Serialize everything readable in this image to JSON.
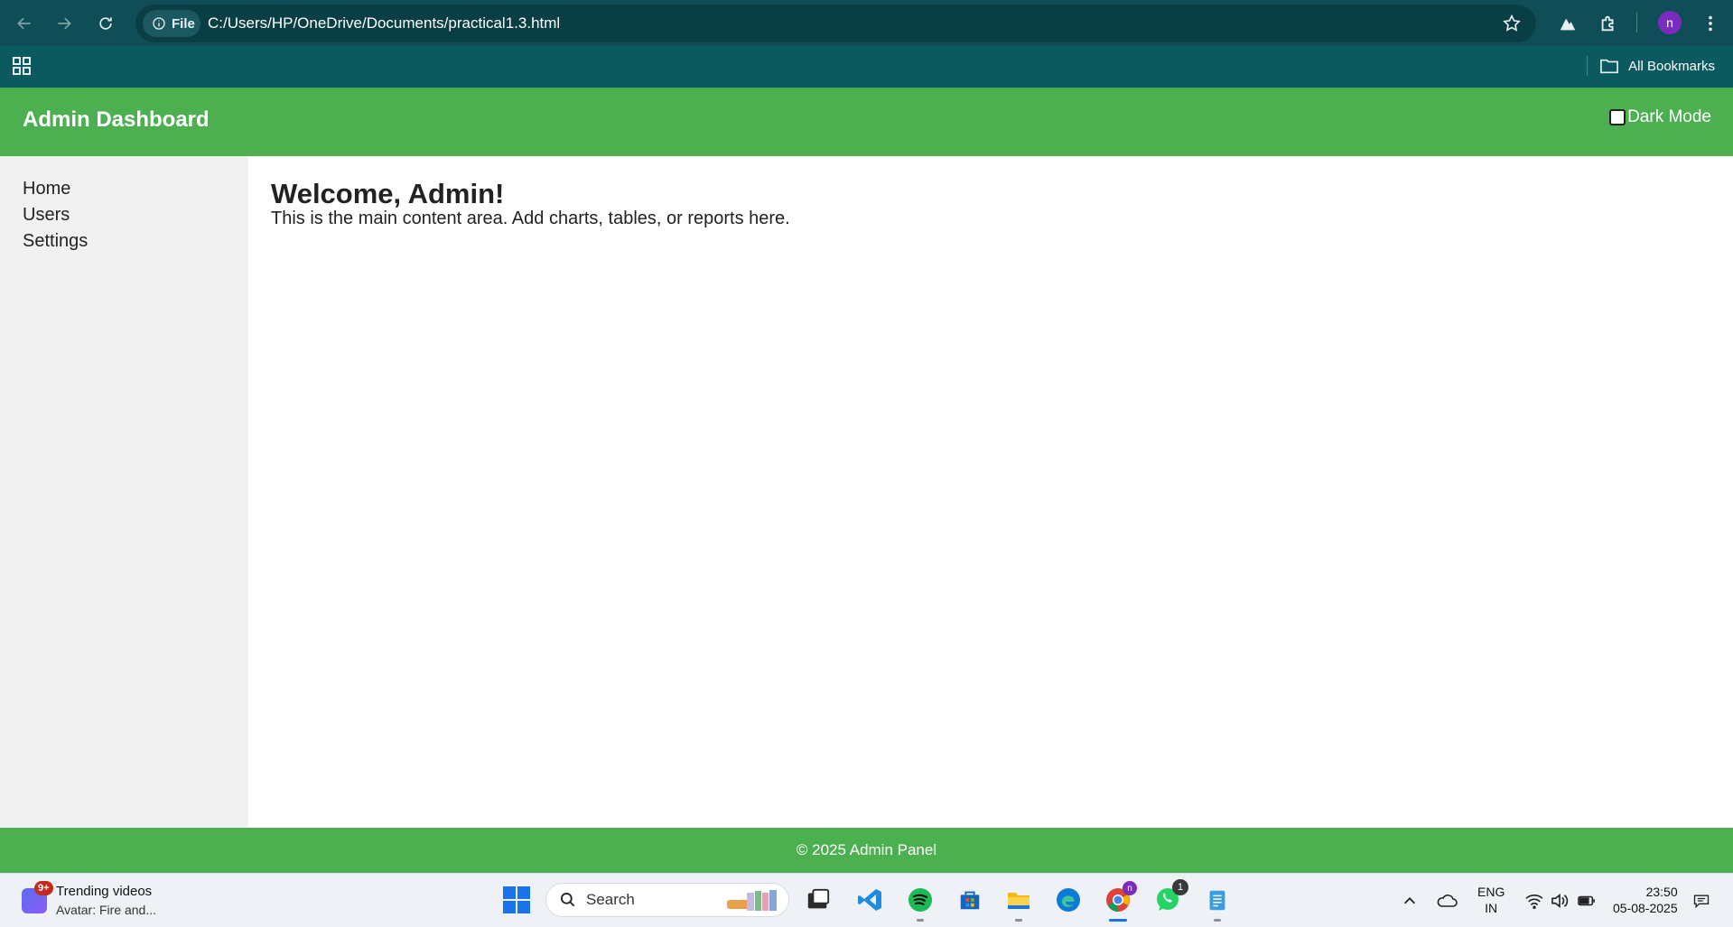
{
  "browser": {
    "site_chip_label": "File",
    "url": "C:/Users/HP/OneDrive/Documents/practical1.3.html",
    "profile_initial": "n",
    "bookmarks_label": "All Bookmarks"
  },
  "app": {
    "title": "Admin Dashboard",
    "dark_mode_label": "Dark Mode",
    "sidebar": {
      "items": [
        {
          "label": "Home"
        },
        {
          "label": "Users"
        },
        {
          "label": "Settings"
        }
      ]
    },
    "main": {
      "heading": "Welcome, Admin!",
      "body": "This is the main content area. Add charts, tables, or reports here."
    },
    "footer": "© 2025 Admin Panel",
    "colors": {
      "header": "#4caf50",
      "sidebar": "#f1f1f1"
    }
  },
  "taskbar": {
    "widget": {
      "badge": "9+",
      "title": "Trending videos",
      "subtitle": "Avatar: Fire and..."
    },
    "search_placeholder": "Search",
    "chrome_badge": "n",
    "whatsapp_badge": "1",
    "lang_line1": "ENG",
    "lang_line2": "IN",
    "time": "23:50",
    "date": "05-08-2025"
  }
}
